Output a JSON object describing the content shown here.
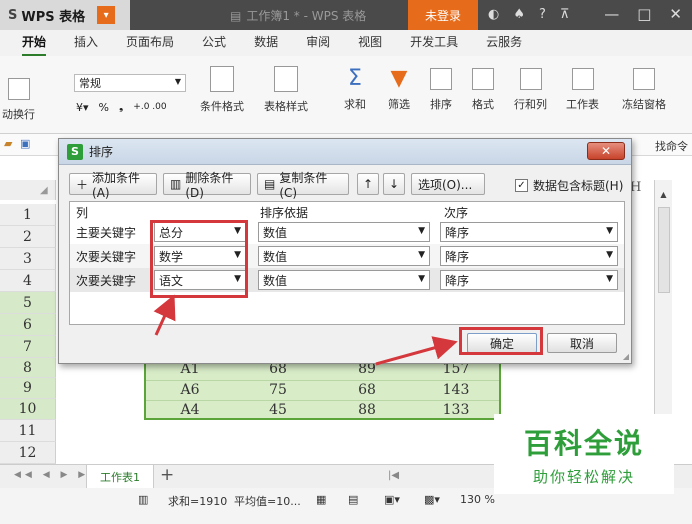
{
  "titlebar": {
    "app": "WPS 表格",
    "doc_title": "工作簿1 * - WPS 表格",
    "login": "未登录",
    "help": "?"
  },
  "menu": [
    "开始",
    "插入",
    "页面布局",
    "公式",
    "数据",
    "审阅",
    "视图",
    "开发工具",
    "云服务"
  ],
  "ribbon": {
    "wrap": "动换行",
    "number_format": "常规",
    "percent": "%",
    "comma": "❟",
    "inc_dec": "+.0 .00",
    "cond_format": "条件格式",
    "table_style": "表格样式",
    "sum": "求和",
    "filter": "筛选",
    "sort": "排序",
    "format": "格式",
    "rowcol": "行和列",
    "worksheet": "工作表",
    "freeze": "冻结窗格",
    "find_cmd": "找命令"
  },
  "rows": [
    "1",
    "2",
    "3",
    "4",
    "5",
    "6",
    "7",
    "8",
    "9",
    "10",
    "11",
    "12"
  ],
  "cells": [
    {
      "name": "A1",
      "math": "68",
      "chinese": "89",
      "total": "157"
    },
    {
      "name": "A6",
      "math": "75",
      "chinese": "68",
      "total": "143"
    },
    {
      "name": "A4",
      "math": "45",
      "chinese": "88",
      "total": "133"
    }
  ],
  "column_header": "H",
  "sheet": {
    "tab": "工作表1",
    "add": "+"
  },
  "status": {
    "sum": "求和=1910",
    "avg": "平均值=10...",
    "zoom": "130 %"
  },
  "watermark": {
    "title": "百科全说",
    "subtitle": "助你轻松解决"
  },
  "dialog": {
    "title": "排序",
    "add_condition": "添加条件(A)",
    "delete_condition": "删除条件(D)",
    "copy_condition": "复制条件(C)",
    "options": "选项(O)...",
    "header_checkbox": "数据包含标题(H)",
    "header_checked": true,
    "col_header": "列",
    "basis_header": "排序依据",
    "order_header": "次序",
    "keys": [
      {
        "label": "主要关键字",
        "column": "总分",
        "basis": "数值",
        "order": "降序"
      },
      {
        "label": "次要关键字",
        "column": "数学",
        "basis": "数值",
        "order": "降序"
      },
      {
        "label": "次要关键字",
        "column": "语文",
        "basis": "数值",
        "order": "降序"
      }
    ],
    "ok": "确定",
    "cancel": "取消"
  },
  "colors": {
    "accent_green": "#2e9e3a",
    "highlight_red": "#d4383d",
    "login_orange": "#e66b1a",
    "selection_green": "#d8ecc8"
  }
}
